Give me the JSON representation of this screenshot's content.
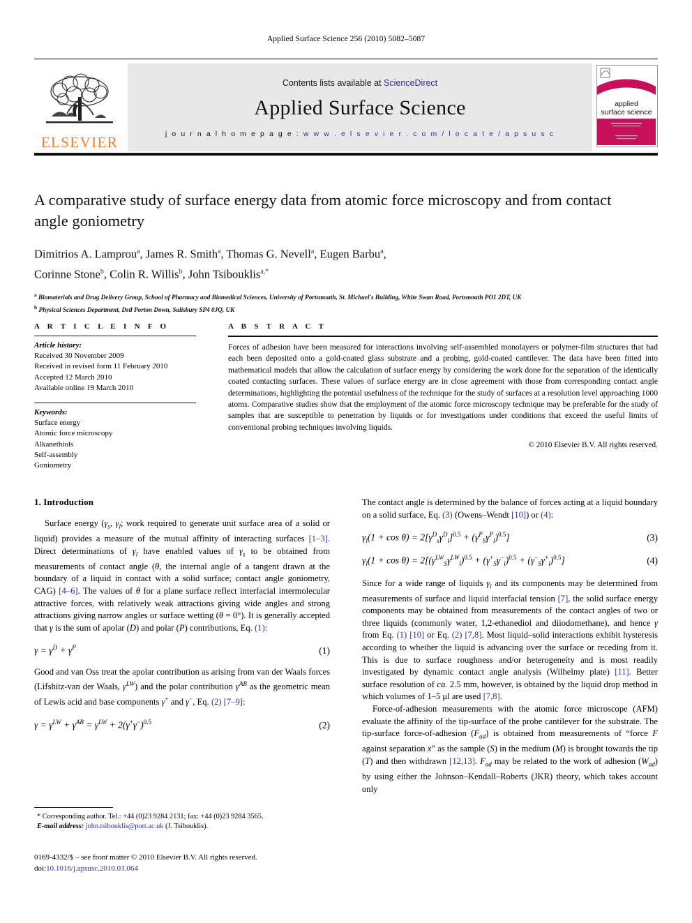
{
  "running_head": "Applied Surface Science 256 (2010) 5082–5087",
  "masthead": {
    "publisher_name": "ELSEVIER",
    "contents_prefix": "Contents lists available at ",
    "contents_link": "ScienceDirect",
    "journal_title": "Applied Surface Science",
    "homepage_label": "j o u r n a l   h o m e p a g e :  ",
    "homepage_url": "w w w . e l s e v i e r . c o m / l o c a t e / a p s u s c",
    "cover_title_line1": "applied",
    "cover_title_line2": "surface science",
    "cover_color": "#c8105a",
    "logo_color": "#f47a20",
    "link_color": "#2e3192"
  },
  "article": {
    "title": "A comparative study of surface energy data from atomic force microscopy and from contact angle goniometry",
    "authors_line1": "Dimitrios A. Lamprou<sup>a</sup>, James R. Smith<sup>a</sup>, Thomas G. Nevell<sup>a</sup>, Eugen Barbu<sup>a</sup>,",
    "authors_line2": "Corinne Stone<sup>b</sup>, Colin R. Willis<sup>b</sup>, John Tsibouklis<sup>a,*</sup>",
    "affiliation_a": "<sup>a</sup> Biomaterials and Drug Delivery Group, School of Pharmacy and Biomedical Sciences, University of Portsmouth, St. Michael's Building, White Swan Road, Portsmouth PO1 2DT, UK",
    "affiliation_b": "<sup>b</sup> Physical Sciences Department, Dstl Porton Down, Salisbury SP4 0JQ, UK"
  },
  "article_info": {
    "heading": "A R T I C L E   I N F O",
    "history_label": "Article history:",
    "history": [
      "Received 30 November 2009",
      "Received in revised form 11 February 2010",
      "Accepted 12 March 2010",
      "Available online 19 March 2010"
    ],
    "keywords_label": "Keywords:",
    "keywords": [
      "Surface energy",
      "Atomic force microscopy",
      "Alkanethiols",
      "Self-assembly",
      "Goniometry"
    ]
  },
  "abstract": {
    "heading": "A B S T R A C T",
    "text": "Forces of adhesion have been measured for interactions involving self-assembled monolayers or polymer-film structures that had each been deposited onto a gold-coated glass substrate and a probing, gold-coated cantilever. The data have been fitted into mathematical models that allow the calculation of surface energy by considering the work done for the separation of the identically coated contacting surfaces. These values of surface energy are in close agreement with those from corresponding contact angle determinations, highlighting the potential usefulness of the technique for the study of surfaces at a resolution level approaching 1000 atoms. Comparative studies show that the employment of the atomic force microscopy technique may be preferable for the study of samples that are susceptible to penetration by liquids or for investigations under conditions that exceed the useful limits of conventional probing techniques involving liquids.",
    "copyright": "© 2010 Elsevier B.V. All rights reserved."
  },
  "body": {
    "section1_heading": "1. Introduction",
    "left_p1": "Surface energy (<i>γ</i><span class=\"sub\">s</span>, <i>γ</i><span class=\"sub\">l</span>; work required to generate unit surface area of a solid or liquid) provides a measure of the mutual affinity of interacting surfaces <span class=\"ref\">[1–3]</span>. Direct determinations of <i>γ</i><span class=\"sub\">l</span> have enabled values of <i>γ</i><span class=\"sub\">s</span> to be obtained from measurements of contact angle (<i>θ</i>, the internal angle of a tangent drawn at the boundary of a liquid in contact with a solid surface; contact angle goniometry, CAG) <span class=\"ref\">[4–6]</span>. The values of <i>θ</i> for a plane surface reflect interfacial intermolecular attractive forces, with relatively weak attractions giving wide angles and strong attractions giving narrow angles or surface wetting (<i>θ</i> = 0°). It is generally accepted that <i>γ</i> is the sum of apolar (<i>D</i>) and polar (<i>P</i>) contributions, Eq. <span class=\"ref\">(1)</span>:",
    "eq1": "<i>γ</i> = <i>γ</i><span class=\"up\">D</span> + <i>γ</i><span class=\"up\">P</span>",
    "eq1_num": "(1)",
    "left_p2": "Good and van Oss treat the apolar contribution as arising from van der Waals forces (Lifshitz-van der Waals, <i>γ</i><span class=\"sup it\">LW</span>) and the polar contribution <i>γ</i><span class=\"sup it\">AB</span> as the geometric mean of Lewis acid and base components <i>γ</i><span class=\"sup\">+</span> and <i>γ</i><span class=\"sup\">−</span>, Eq. <span class=\"ref\">(2)</span> <span class=\"ref\">[7–9]</span>:",
    "eq2": "<i>γ</i> = <i>γ</i><span class=\"up\">LW</span> + <i>γ</i><span class=\"up\">AB</span> = <i>γ</i><span class=\"up\">LW</span> + 2(<i>γ</i><span class=\"upn\">+</span><i>γ</i><span class=\"upn\">−</span>)<span class=\"upn\">0.5</span>",
    "eq2_num": "(2)",
    "right_p1": "The contact angle is determined by the balance of forces acting at a liquid boundary on a solid surface, Eq. <span class=\"ref\">(3)</span> (Owens–Wendt <span class=\"ref\">[10]</span>) or <span class=\"ref\">(4)</span>:",
    "eq3": "<i>γ</i><span class=\"dn\">l</span>(1 + cos <i>θ</i>) = 2[<i>γ</i><span class=\"up\">D</span><span class=\"dn\">s</span><i>γ</i><span class=\"up\">D</span><span class=\"dn\">l</span>]<span class=\"upn\">0.5</span> + (<i>γ</i><span class=\"up\">P</span><span class=\"dn\">S</span><i>γ</i><span class=\"up\">P</span><span class=\"dn\">l</span>)<span class=\"upn\">0.5</span>]",
    "eq3_num": "(3)",
    "eq4": "<i>γ</i><span class=\"dn\">l</span>(1 + cos <i>θ</i>) = 2[(<i>γ</i><span class=\"up\">LW</span><span class=\"dn\">S</span><i>γ</i><span class=\"up\">LW</span><span class=\"dn\">l</span>)<span class=\"upn\">0.5</span> + (<i>γ</i><span class=\"upn\">+</span><span class=\"dn\">S</span><i>γ</i><span class=\"upn\">−</span><span class=\"dn\">l</span>)<span class=\"upn\">0.5</span> + (<i>γ</i><span class=\"upn\">−</span><span class=\"dn\">S</span><i>γ</i><span class=\"upn\">+</span><span class=\"dn\">l</span>)<span class=\"upn\">0.5</span>]",
    "eq4_num": "(4)",
    "right_p2": "Since for a wide range of liquids <i>γ</i><span class=\"sub\">l</span> and its components may be determined from measurements of surface and liquid interfacial tension <span class=\"ref\">[7]</span>, the solid surface energy components may be obtained from measurements of the contact angles of two or three liquids (commonly water, 1,2-ethanediol and diiodomethane), and hence <i>γ</i> from Eq. <span class=\"ref\">(1)</span> <span class=\"ref\">[10]</span> or Eq. <span class=\"ref\">(2)</span> <span class=\"ref\">[7,8]</span>. Most liquid–solid interactions exhibit hysteresis according to whether the liquid is advancing over the surface or receding from it. This is due to surface roughness and/or heterogeneity and is most readily investigated by dynamic contact angle analysis (Wilhelmy plate) <span class=\"ref\">[11]</span>. Better surface resolution of <i>ca.</i> 2.5 mm, however, is obtained by the liquid drop method in which volumes of 1–5 μl are used <span class=\"ref\">[7,8]</span>.",
    "right_p3": "Force-of-adhesion measurements with the atomic force microscope (AFM) evaluate the affinity of the tip-surface of the probe cantilever for the substrate. The tip-surface force-of-adhesion (<i>F</i><span class=\"sub\">ad</span>) is obtained from measurements of “force <i>F</i> against separation <i>x</i>” as the sample (<i>S</i>) in the medium (<i>M</i>) is brought towards the tip (<i>T</i>) and then withdrawn <span class=\"ref\">[12,13]</span>. <i>F</i><span class=\"sub\">ad</span> may be related to the work of adhesion (<i>W</i><span class=\"sub\">ad</span>) by using either the Johnson–Kendall–Roberts (JKR) theory, which takes account only"
  },
  "footnote": {
    "line1": "* Corresponding author. Tel.: +44 (0)23 9284 2131; fax: +44 (0)23 9284 3565.",
    "email_label": "E-mail address:",
    "email": "john.tsibouklis@port.ac.uk",
    "email_suffix": "(J. Tsibouklis)."
  },
  "footer": {
    "issn_line": "0169-4332/$ – see front matter © 2010 Elsevier B.V. All rights reserved.",
    "doi_label": "doi:",
    "doi": "10.1016/j.apsusc.2010.03.064"
  }
}
